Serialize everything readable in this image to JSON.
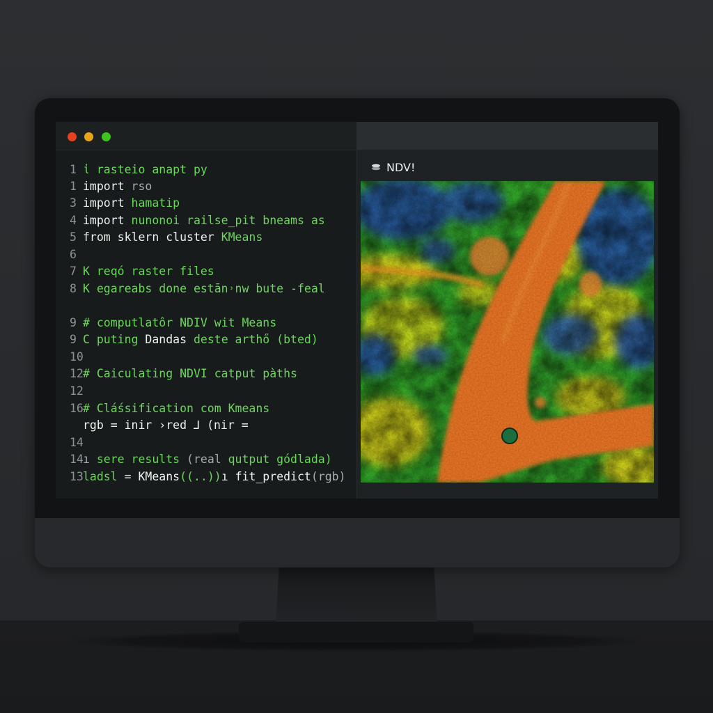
{
  "editor": {
    "lines": [
      {
        "num": "1",
        "parts": [
          [
            "cm",
            "ἰ rasteio anapt py"
          ]
        ]
      },
      {
        "num": "1",
        "parts": [
          [
            "kw",
            "import "
          ],
          [
            "gy",
            "rso"
          ]
        ]
      },
      {
        "num": "3",
        "parts": [
          [
            "kw",
            "import "
          ],
          [
            "gr",
            "hamatip"
          ]
        ]
      },
      {
        "num": "4",
        "parts": [
          [
            "kw",
            "import "
          ],
          [
            "gr",
            "nunonoi railse_pit bneams as"
          ]
        ]
      },
      {
        "num": "5",
        "parts": [
          [
            "kw",
            "from sklern cluster "
          ],
          [
            "gr",
            "KMeans"
          ]
        ]
      },
      {
        "num": "6",
        "parts": []
      },
      {
        "num": "7",
        "parts": [
          [
            "cm",
            "K reqó raster files"
          ]
        ]
      },
      {
        "num": "8",
        "parts": [
          [
            "cm",
            "K egareabs done estān˒nw bute -feal"
          ]
        ]
      },
      {
        "num": "9",
        "parts": [
          [
            "cm",
            "# computlatôr NDIV wit Means"
          ]
        ]
      },
      {
        "num": "9",
        "parts": [
          [
            "gr",
            "C puting "
          ],
          [
            "wt",
            "Dandas "
          ],
          [
            "gr",
            "deste arthő (bted)"
          ]
        ]
      },
      {
        "num": "10",
        "parts": []
      },
      {
        "num": "12",
        "parts": [
          [
            "cm",
            "# Caiculating NDVI "
          ],
          [
            "gr",
            "catput pàths"
          ]
        ]
      },
      {
        "num": "12",
        "parts": []
      },
      {
        "num": "16",
        "parts": [
          [
            "cm",
            "# Cláśsification com Kmeans"
          ]
        ]
      },
      {
        "num": "",
        "parts": [
          [
            "wt",
            "rgb = inir ›red ⅃ (nir ="
          ]
        ]
      },
      {
        "num": "14",
        "parts": []
      },
      {
        "num": "14",
        "parts": [
          [
            "gy",
            "ı "
          ],
          [
            "cm",
            "sere results "
          ],
          [
            "gy",
            "(real "
          ],
          [
            "gr",
            "qutput gódlada)"
          ]
        ]
      },
      {
        "num": "13",
        "parts": [
          [
            "gr",
            "ladsl "
          ],
          [
            "wt",
            "= KMeans"
          ],
          [
            "gr",
            "((..))"
          ],
          [
            "wt",
            "ı fit_predict"
          ],
          [
            "gy",
            "(rgb)"
          ]
        ]
      }
    ]
  },
  "viewer": {
    "title": "NDV!",
    "icon": "layers-icon"
  },
  "colors": {
    "accent_green": "#6ad65a",
    "traffic_red": "#e9401e",
    "traffic_yellow": "#e9a319",
    "traffic_green": "#3ec21f",
    "ndvi_low": "#2a5fb0",
    "ndvi_mid": "#36b52c",
    "ndvi_high": "#f2e21c",
    "road": "#f57a26"
  }
}
